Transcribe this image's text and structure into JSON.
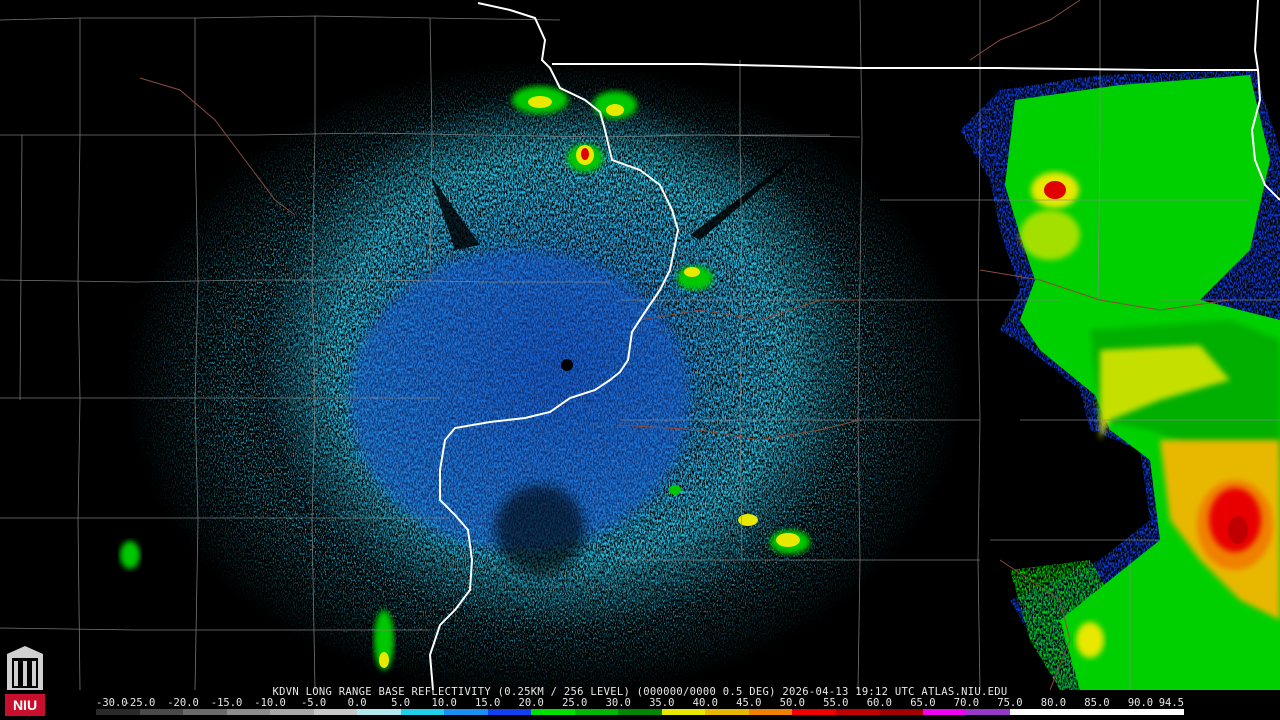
{
  "caption": "KDVN LONG RANGE BASE REFLECTIVITY (0.25KM / 256 LEVEL) (000000/0000 0.5 DEG) 2026-04-13 19:12 UTC  ATLAS.NIU.EDU",
  "scale": {
    "labels": [
      "-30.0",
      "-25.0",
      "-20.0",
      "-15.0",
      "-10.0",
      "-5.0",
      "0.0",
      "5.0",
      "10.0",
      "15.0",
      "20.0",
      "25.0",
      "30.0",
      "35.0",
      "40.0",
      "45.0",
      "50.0",
      "55.0",
      "60.0",
      "65.0",
      "70.0",
      "75.0",
      "80.0",
      "85.0",
      "90.0",
      "94.5"
    ],
    "colors": [
      "#2a2a2a",
      "#4a4a4a",
      "#6a6a6a",
      "#8c8c8c",
      "#a8a8a8",
      "#c8c8c8",
      "#b0e8f0",
      "#20d0e8",
      "#1a90f0",
      "#1040f0",
      "#00e000",
      "#00b800",
      "#008800",
      "#e8e800",
      "#e8b800",
      "#f08000",
      "#f00000",
      "#c00000",
      "#a00000",
      "#f000f0",
      "#9838c8",
      "#ffffff",
      "#ffffff",
      "#ffffff",
      "#ffffff"
    ]
  },
  "logo": {
    "text": "NIU",
    "bg": "#c8102e"
  },
  "colors": {
    "state_border": "#ffffff",
    "county_line": "#8a8a8a",
    "river": "#8a4a3a",
    "radar_site": "#000000"
  }
}
